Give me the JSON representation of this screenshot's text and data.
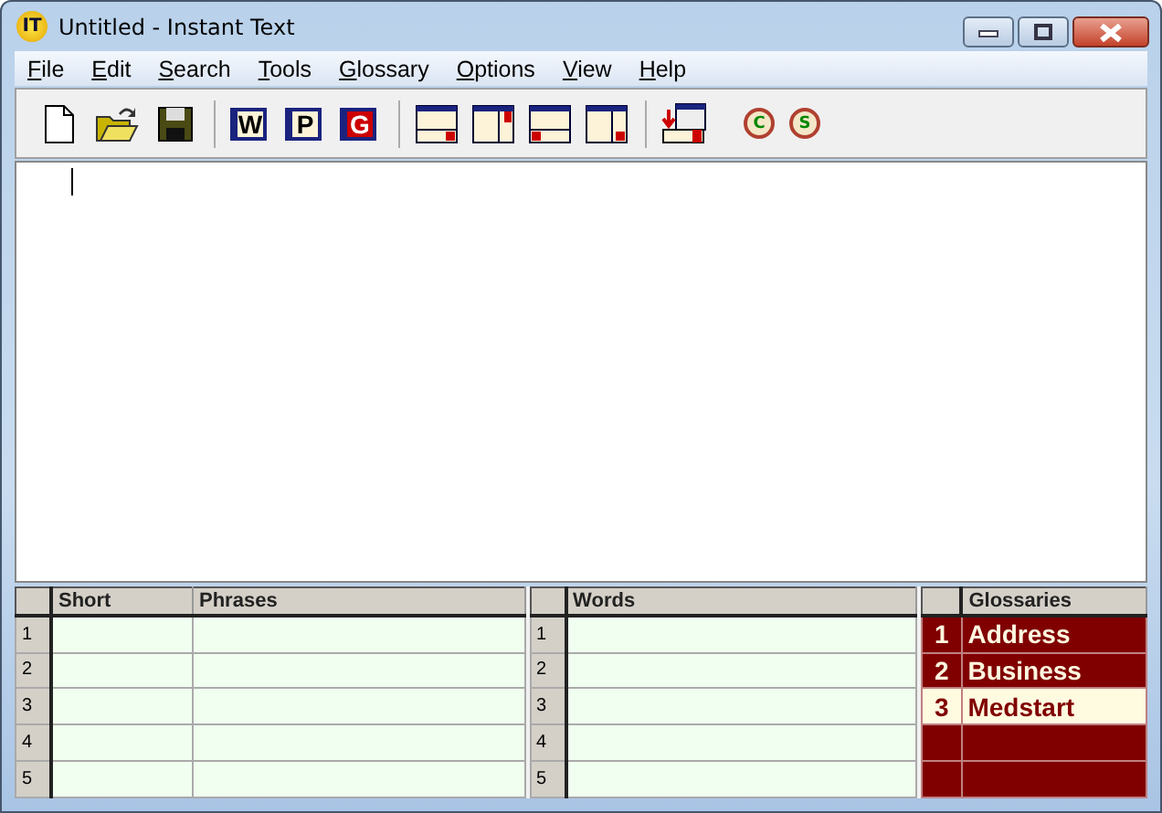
{
  "window": {
    "title": "Untitled - Instant Text",
    "logo": "IT"
  },
  "menu": [
    "File",
    "Edit",
    "Search",
    "Tools",
    "Glossary",
    "Options",
    "View",
    "Help"
  ],
  "toolbar": {
    "letters": [
      {
        "text": "W",
        "kind": "word"
      },
      {
        "text": "P",
        "kind": "phrase"
      },
      {
        "text": "G",
        "kind": "glossary"
      }
    ],
    "circles": [
      "C",
      "S"
    ]
  },
  "phrases": {
    "columns": [
      "Short",
      "Phrases"
    ],
    "rows": [
      "1",
      "2",
      "3",
      "4",
      "5"
    ]
  },
  "words": {
    "columns": [
      "Words"
    ],
    "rows": [
      "1",
      "2",
      "3",
      "4",
      "5"
    ]
  },
  "glossaries": {
    "column": "Glossaries",
    "rows": [
      {
        "number": "1",
        "name": "Address",
        "selected": false
      },
      {
        "number": "2",
        "name": "Business",
        "selected": false
      },
      {
        "number": "3",
        "name": "Medstart",
        "selected": true
      }
    ]
  }
}
